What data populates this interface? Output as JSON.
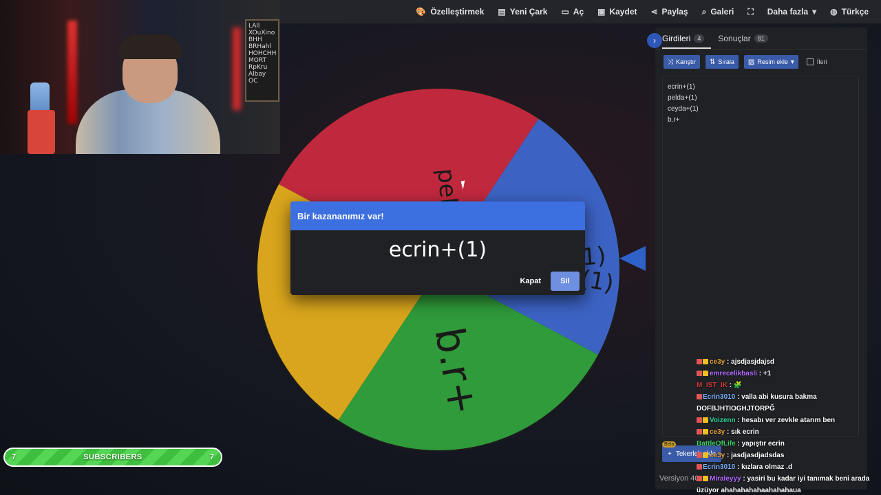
{
  "nav": {
    "items": [
      {
        "label": "Özelleştirmek",
        "icon": "palette-icon"
      },
      {
        "label": "Yeni Çark",
        "icon": "file-icon"
      },
      {
        "label": "Aç",
        "icon": "folder-icon"
      },
      {
        "label": "Kaydet",
        "icon": "save-icon"
      },
      {
        "label": "Paylaş",
        "icon": "share-icon"
      },
      {
        "label": "Galeri",
        "icon": "search-icon"
      },
      {
        "label": "",
        "icon": "fullscreen-icon"
      },
      {
        "label": "Daha fazla",
        "icon": "chevron-down-icon"
      },
      {
        "label": "Türkçe",
        "icon": "globe-icon"
      }
    ]
  },
  "webcam": {
    "board_text": "LAll\nXOuXino\nBHH\nBRHahl\nHOHCHH\nMORT\nRpKru\nAlbay\nOC"
  },
  "wheel": {
    "segments": [
      {
        "label": "pelda+(1)",
        "color": "#c0283d"
      },
      {
        "label": "(1)",
        "color": "#3c63c4"
      },
      {
        "label": "b.r+",
        "color": "#2f9b3a"
      },
      {
        "label": "(1)",
        "color": "#d9a51c"
      }
    ]
  },
  "modal": {
    "title": "Bir kazananımız var!",
    "winner": "ecrin+(1)",
    "close_label": "Kapat",
    "delete_label": "Sil"
  },
  "panel": {
    "tabs": [
      {
        "label": "Girdileri",
        "count": "4"
      },
      {
        "label": "Sonuçlar",
        "count": "81"
      }
    ],
    "toolbar": {
      "shuffle_label": "Karıştır",
      "sort_label": "Sırala",
      "add_image_label": "Resim ekle",
      "advanced_label": "İleri"
    },
    "entries": [
      "ecrin+(1)",
      "pelda+(1)",
      "ceyda+(1)",
      "b.r+"
    ],
    "beta_label": "Beta",
    "add_button_label": "Tekerlek ekle",
    "version_label": "Versiyon 40"
  },
  "chat": [
    {
      "user": "ce3y",
      "color": "#e6a33a",
      "message": "ajsdjasjdajsd"
    },
    {
      "user": "emrecelikbasli",
      "color": "#b36cff",
      "message": "+1"
    },
    {
      "user": "M_IST_IK",
      "color": "#d23a3a",
      "message": "🧩"
    },
    {
      "user": "Ecrin3010",
      "color": "#7fb2ff",
      "message": "valla abi kusura bakma DOFBJHTIOGHJTORPĞ"
    },
    {
      "user": "Voizenn",
      "color": "#2fd69a",
      "message": "hesabı ver zevkle atarım ben"
    },
    {
      "user": "ce3y",
      "color": "#e6a33a",
      "message": "sık ecrin"
    },
    {
      "user": "BattleOfLife",
      "color": "#3fcf6a",
      "message": "yapıştır ecrin"
    },
    {
      "user": "ce3y",
      "color": "#e6a33a",
      "message": "jasdjasdjadsdas"
    },
    {
      "user": "Ecrin3010",
      "color": "#7fb2ff",
      "message": "kızlara olmaz .d"
    },
    {
      "user": "Miraleyyy",
      "color": "#b36cff",
      "message": "yasiri bu kadar iyi tanımak beni arada üzüyor ahahahahahaahahahaua"
    }
  ],
  "subscribers": {
    "label": "SUBSCRIBERS",
    "left_count": "7",
    "right_count": "7"
  }
}
